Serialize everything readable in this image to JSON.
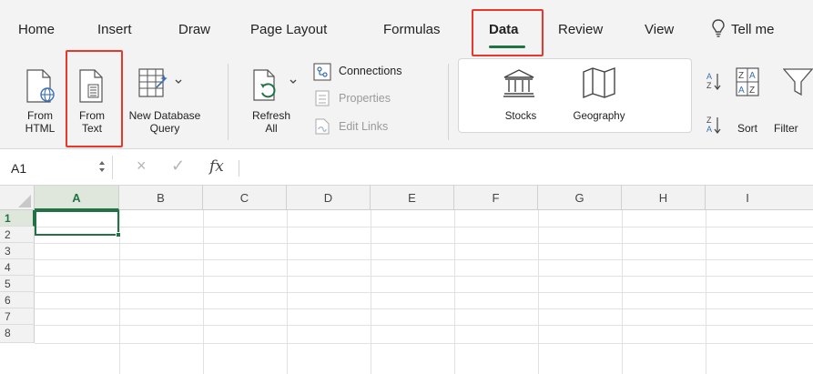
{
  "tabs": [
    "Home",
    "Insert",
    "Draw",
    "Page Layout",
    "Formulas",
    "Data",
    "Review",
    "View",
    "Tell me"
  ],
  "active_tab": "Data",
  "ribbon": {
    "from_html": [
      "From",
      "HTML"
    ],
    "from_text": [
      "From",
      "Text"
    ],
    "new_db_query": [
      "New Database",
      "Query"
    ],
    "refresh_all": [
      "Refresh",
      "All"
    ],
    "connections": "Connections",
    "properties": "Properties",
    "edit_links": "Edit Links",
    "stocks": "Stocks",
    "geography": "Geography",
    "sort": "Sort",
    "filter": "Filter"
  },
  "formula_bar": {
    "name_box": "A1",
    "fx": "fx",
    "cancel": "×",
    "enter": "✓"
  },
  "grid": {
    "columns": [
      "A",
      "B",
      "C",
      "D",
      "E",
      "F",
      "G",
      "H",
      "I"
    ],
    "rows": [
      "1",
      "2",
      "3",
      "4",
      "5",
      "6",
      "7",
      "8"
    ],
    "selected_cell": "A1"
  },
  "colors": {
    "accent": "#217346",
    "highlight": "#e8382e",
    "ribbon_bg": "#f3f3f3"
  }
}
